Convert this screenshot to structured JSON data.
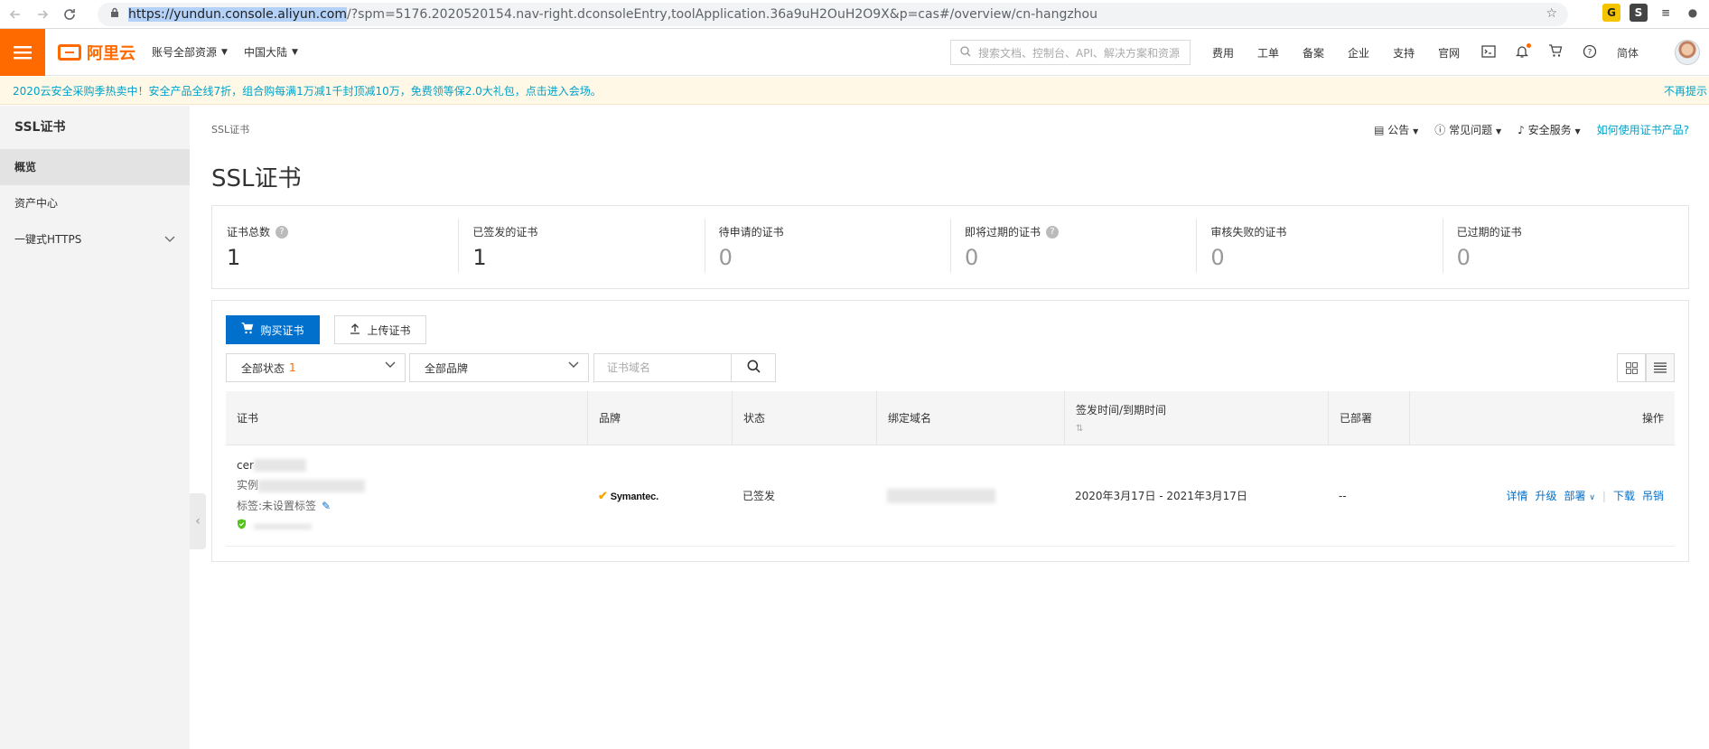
{
  "browser": {
    "url_host": "https://yundun.console.aliyun.com",
    "url_rest": "/?spm=5176.2020520154.nav-right.dconsoleEntry,toolApplication.36a9uH2OuH2O9X&p=cas#/overview/cn-hangzhou"
  },
  "topbar": {
    "logo": "阿里云",
    "account_select": "账号全部资源",
    "region_select": "中国大陆",
    "search_placeholder": "搜索文档、控制台、API、解决方案和资源",
    "links": [
      "费用",
      "工单",
      "备案",
      "企业",
      "支持",
      "官网"
    ],
    "lang": "简体"
  },
  "promo": {
    "text": "2020云安全采购季热卖中！安全产品全线7折，组合购每满1万减1千封顶减10万，免费领等保2.0大礼包，点击进入会场。",
    "dismiss": "不再提示"
  },
  "sidebar": {
    "title": "SSL证书",
    "items": [
      {
        "label": "概览"
      },
      {
        "label": "资产中心"
      },
      {
        "label": "一键式HTTPS"
      }
    ]
  },
  "header": {
    "breadcrumb": "SSL证书",
    "title": "SSL证书",
    "actions": {
      "announcement": "公告",
      "faq": "常见问题",
      "security_services": "安全服务",
      "help_link": "如何使用证书产品?"
    }
  },
  "stats": [
    {
      "label": "证书总数",
      "value": "1"
    },
    {
      "label": "已签发的证书",
      "value": "1"
    },
    {
      "label": "待申请的证书",
      "value": "0"
    },
    {
      "label": "即将过期的证书",
      "value": "0"
    },
    {
      "label": "审核失败的证书",
      "value": "0"
    },
    {
      "label": "已过期的证书",
      "value": "0"
    }
  ],
  "toolbar": {
    "buy_label": "购买证书",
    "upload_label": "上传证书",
    "status_filter": "全部状态",
    "status_count": "1",
    "brand_filter": "全部品牌",
    "domain_placeholder": "证书域名"
  },
  "table": {
    "columns": [
      "证书",
      "品牌",
      "状态",
      "绑定域名",
      "签发时间/到期时间",
      "已部署",
      "操作"
    ],
    "rows": [
      {
        "cert_name_prefix": "cer",
        "instance_prefix": "实例",
        "tag_text": "标签:未设置标签",
        "brand": "Symantec.",
        "status": "已签发",
        "validity": "2020年3月17日 - 2021年3月17日",
        "deployed": "--",
        "actions": [
          "详情",
          "升级",
          "部署",
          "下载",
          "吊销"
        ]
      }
    ]
  },
  "colors": {
    "brand_orange": "#ff6a00",
    "primary_blue": "#0070cc",
    "link_blue": "#00a2ca"
  }
}
